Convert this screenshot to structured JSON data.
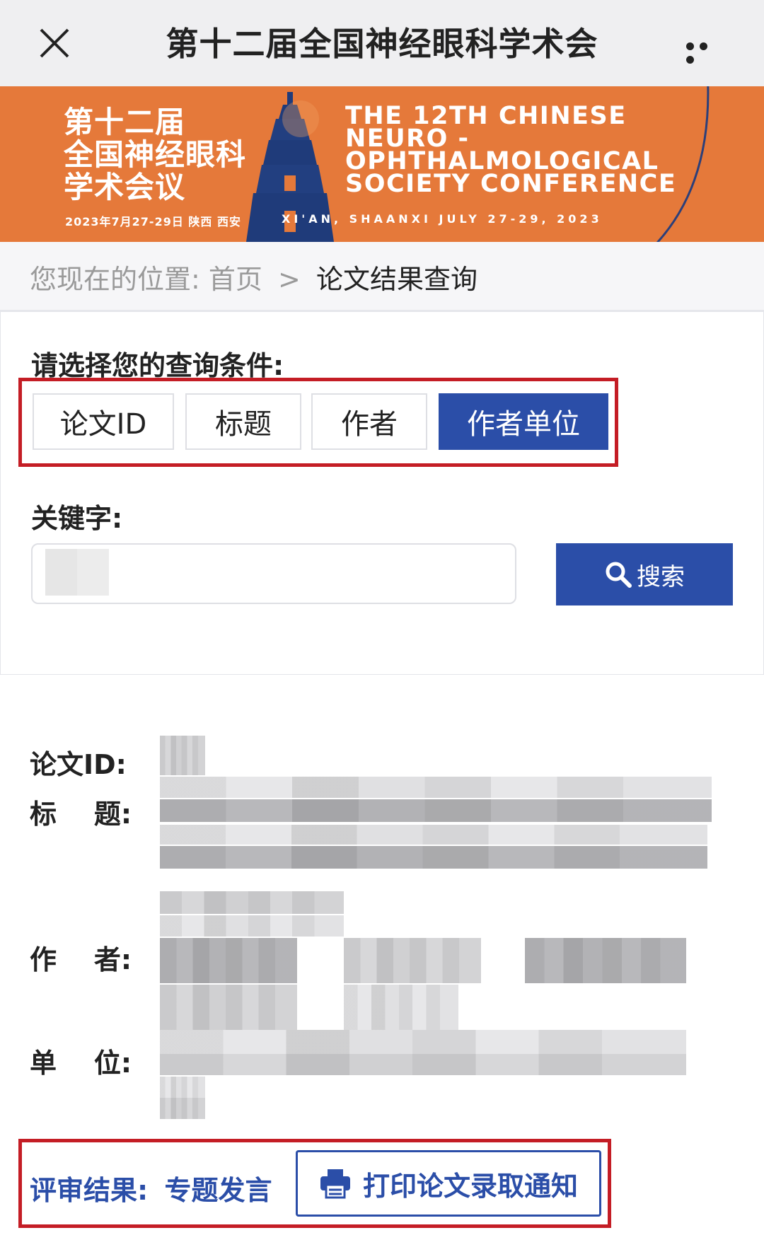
{
  "navbar": {
    "title": "第十二届全国神经眼科学术会"
  },
  "banner": {
    "cn_line1": "第十二届",
    "cn_line2": "全国神经眼科",
    "cn_line3": "学术会议",
    "date": "2023年7月27-29日  陕西 西安",
    "en_line1": "THE 12TH CHINESE",
    "en_line2": "NEURO -",
    "en_line3": "OPHTHALMOLOGICAL",
    "en_line4": "SOCIETY CONFERENCE",
    "location": "XI'AN, SHAANXI JULY 27-29, 2023"
  },
  "breadcrumb": {
    "prefix": "您现在的位置:",
    "home": "首页",
    "separator": ">",
    "current": "论文结果查询"
  },
  "search": {
    "criteria_label": "请选择您的查询条件:",
    "options": [
      "论文ID",
      "标题",
      "作者",
      "作者单位"
    ],
    "selected": "作者单位",
    "keyword_label": "关键字:",
    "keyword_value": "",
    "button_label": "搜索"
  },
  "result": {
    "id_label": "论文ID:",
    "title_label": "标    题:",
    "author_label": "作    者:",
    "unit_label": "单    位:",
    "review_label": "评审结果:",
    "review_value": "专题发言",
    "print_button": "打印论文录取通知"
  },
  "colors": {
    "accent_blue": "#2b4ea8",
    "highlight_red": "#c41d25",
    "banner_orange": "#e5793a"
  }
}
